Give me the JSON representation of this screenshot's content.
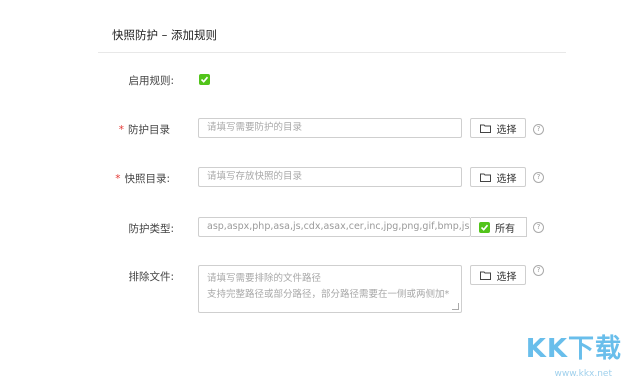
{
  "header": {
    "title": "快照防护 – 添加规则"
  },
  "form": {
    "enable": {
      "label": "启用规则:",
      "checked": true
    },
    "protect_dir": {
      "label": "防护目录",
      "required": true,
      "placeholder": "请填写需要防护的目录",
      "button": "选择"
    },
    "snapshot_dir": {
      "label": "快照目录:",
      "required": true,
      "placeholder": "请填写存放快照的目录",
      "button": "选择"
    },
    "protect_type": {
      "label": "防护类型:",
      "value": "asp,aspx,php,asa,js,cdx,asax,cer,inc,jpg,png,gif,bmp,jsp",
      "all_label": "所有",
      "all_checked": true
    },
    "exclude_files": {
      "label": "排除文件:",
      "line1": "请填写需要排除的文件路径",
      "line2": "支持完整路径或部分路径，部分路径需要在一侧或两侧加*",
      "button": "选择"
    },
    "help_icon": "?"
  },
  "watermark": {
    "text": "KK下载",
    "url": "www.kkx.net"
  },
  "colors": {
    "accent_green": "#52c41a",
    "required_red": "#e53935"
  }
}
